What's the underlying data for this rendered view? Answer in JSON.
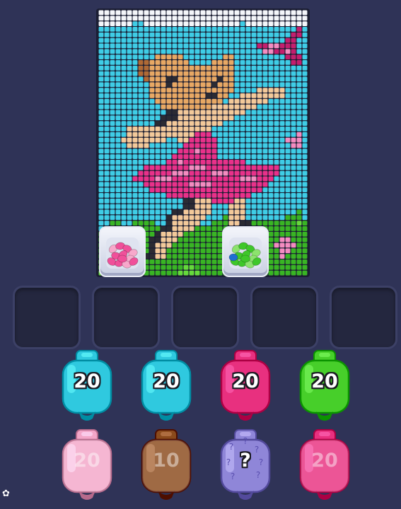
{
  "jar_colors": {
    "cyan": "#2fc9df",
    "pink": "#e8307f",
    "green": "#47cf2a",
    "light_pink": "#f3a6c8",
    "brown": "#8a4a1c",
    "mystery": "#8f86d8"
  },
  "buckets": [
    {
      "name": "pink-bead-bucket",
      "bead_color": "#f0509a",
      "bead_color_light": "#f7a8cb"
    },
    {
      "name": "green-bead-bucket",
      "bead_color": "#3fc72a",
      "bead_color_light": "#8ce36d"
    }
  ],
  "slot_count": 5,
  "jars": [
    {
      "row": 0,
      "col": 0,
      "color": "cyan",
      "count": "20",
      "locked": false
    },
    {
      "row": 0,
      "col": 1,
      "color": "cyan",
      "count": "20",
      "locked": false
    },
    {
      "row": 0,
      "col": 2,
      "color": "pink",
      "count": "20",
      "locked": false
    },
    {
      "row": 0,
      "col": 3,
      "color": "green",
      "count": "20",
      "locked": false
    },
    {
      "row": 1,
      "col": 0,
      "color": "light_pink",
      "count": "20",
      "locked": true
    },
    {
      "row": 1,
      "col": 1,
      "color": "brown",
      "count": "10",
      "locked": true
    },
    {
      "row": 1,
      "col": 2,
      "color": "mystery",
      "count": "?",
      "locked": false
    },
    {
      "row": 1,
      "col": 3,
      "color": "pink",
      "count": "20",
      "locked": true
    }
  ],
  "pixel_palette": {
    "W": "#f4f6fa",
    "S": "#3fcde6",
    "T": "#b06a35",
    "O": "#e8a864",
    "F": "#f3c99a",
    "D": "#2b2b33",
    "P": "#e9318a",
    "L": "#f48cc0",
    "K": "#c41f6e",
    "G": "#39b524",
    "H": "#66d93c",
    "B": "#6a3b1e"
  },
  "pixel_rows": [
    "WWWWWWWWWWWWWWWWWWWWWWWWWWWWWWWWWWWWW",
    "WWWWWWWWWWWWWWWWWWWWWWWWWWWWWWWWWWWWW",
    "WWWWWWSSWWWWWWWWWWWWWWWWWSWWWWWWWWWWW",
    "SSSSSSSSSSSSSSSSSSSSSSSSSSSSSSSSSSSKS",
    "SSSSSSSSSSSSSSSSSSSSSSSSSSSSSSSSSSKKS",
    "SSSSSSSSSSSSSSSSSSSSSSSSSSSSSSSSSKKSS",
    "SSSSSSSSSSSSSSSSSSSSSSSSSSSSKKLLKKKSS",
    "SSSSSSSSSSSSSSSSSSSSSSSSSSSSSLLKKLKSS",
    "SSSSSSSSSSOOOOOSSSSSSSOOSSSSSSSSSKKKS",
    "SSSSSSSTTOOOOOOOSSSSOOOOSSSSSSSSSSKKS",
    "SSSSSSSTTOOOOOOOOOOOOOOOSSSSSSSSSSSSS",
    "SSSSSSSTTOOOOOOOOOOOOOOOSSSSSSSSSSSSS",
    "SSSSSSSSTOOODDOOOOOOODOOSSSSSSSSSSSSS",
    "SSSSSSSSSOOODOOOOOOODOOOSSSSSSSSSSSSS",
    "SSSSSSSSSOOOOOOOOOOOOOOOSSSSFFFFFSSSS",
    "SSSSSSSSSOOOOOOOOOODDOOSSFFFFFFFFSSSS",
    "SSSSSSSSSSOOOOOOOOOOOOSFFFFFFFSSSSSSS",
    "SSSSSSSSSSSOOOOOOOOOFFFFFFFFSSSSSSSSS",
    "SSSSSSSSSSSSDDFFFFFFFFFFFFSSSSSSSSSSS",
    "SSSSSSSSSSSDDDFFFFFFFFFFSSSSSSSSSSSSS",
    "SSSSSSSSSSDDFFFFFFFFFFSSSSSSSSSSSSSSS",
    "SSSSSFFFFFFFFFFFFFFFSSSSSSSSSSSSSSSSS",
    "SSSSSFFFFFFFFFFFFPPPSSSSSSSSSSSSSSSLS",
    "SSSSFFFFFFFFSSFFPPPPPSSSSSSSSSSSSLLLS",
    "SSSSSFFFFSSSSSSPPPPPPSSSSSSSSSSSSSLLS",
    "SSSSSSSSSSSSSSPPPLPPPSSSSSSSSSSSSSSSS",
    "SSSSSSSSSSSSSPPPPPPPPSSSSSSSSSSSSSSSS",
    "SSSSSSSSSSSSPPLPPPPPPPPPPPSSSSSSSSSSS",
    "SSSSSSSSPPPPPPPPLLLPPPPPPPPPPPPPSSSSS",
    "SSSSSSSPPPPPPLLLPPPPLLLPPPPPPPPPSSSSS",
    "SSSSSSPPPPLLLPPPPPPPPPPPPLLLPPPSSSSSS",
    "SSSSSSSSPPPPPPPPLLLLPPPPPPPPPPSSSSSSS",
    "SSSSSSSSSPPPPPPPPPPPPPPPPPPPPSSSSSSSS",
    "SSSSSSSSSSSSPPPPPPPPPPPPPPPSSSSSSSSSS",
    "SSSSSSSSSSSSSSSDDFFFPPPPFFSSSSSSSSSSS",
    "SSSSSSSSSSSSSSSDDFFFSSSFFFSSSSSSSSSSS",
    "SSSSSSSSSSSSSDDFFFFFSSSFFFSSSSSSSSSGS",
    "SSSSSSSSSSSSDFFFFFFSSSGFFFSSSSSSSGGGS",
    "SSGGSSGGGGSSDFFFFFSSGGGFFDDGGGGGGGGHG",
    "SGGGGGGGGGGDDFFFFGGGGGGFFDDGGGGGGGGGG",
    "GGGGGGGGGGDFFFFGGGGGGGGFFFDGGGGGGGGGG",
    "GGGGGGGGGDDFFFGGGGGGGGGFFFFDDGGGLLGGG",
    "GGGGGGGGGDFFFGGGGGGGGGGGFFFDDGGLLLLGG",
    "GGGGGGGGGDFFGGGGGGGGGGGGGFFDDGGGLLGGG",
    "GGGGGGGGDDFFGGGGGGGGGGGGGGDDGGGGLGGGG",
    "HHGGGGGGGGGGGGGGGGGGGGGGGGGGGGGGGGGGG",
    "HHHGGGGGGGGGGGGHHGGGGGGGGGGGGGGGGGGGG",
    "HHHHHHHGGGGGGGHHHHGGGGGGGGGGGGGGGGGGG"
  ]
}
